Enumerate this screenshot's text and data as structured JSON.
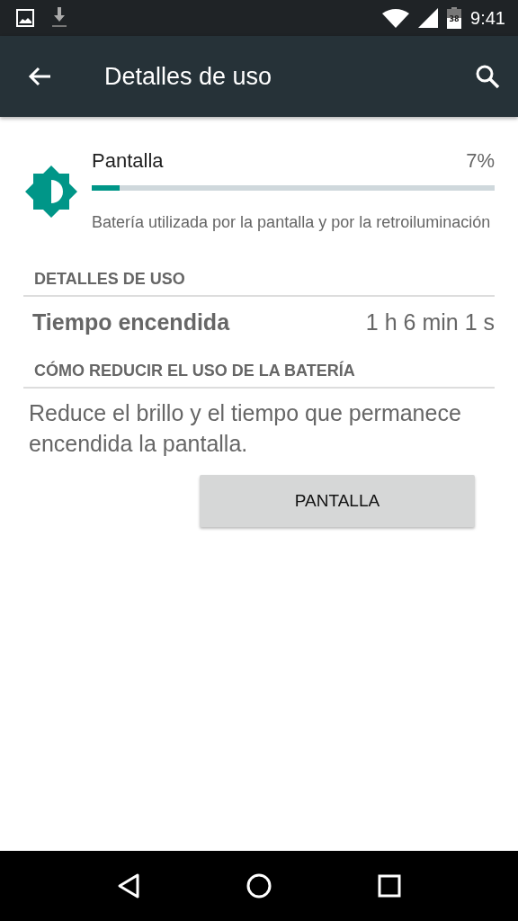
{
  "status_bar": {
    "battery_text": "38",
    "time": "9:41"
  },
  "app_bar": {
    "title": "Detalles de uso"
  },
  "usage": {
    "name": "Pantalla",
    "percent": "7%",
    "level": 0.07,
    "description": "Batería utilizada por la pantalla y por la retroiluminación"
  },
  "sections": [
    {
      "header": "DETALLES DE USO",
      "kind": "stat",
      "label": "Tiempo encendida",
      "value": "1 h 6 min 1 s"
    },
    {
      "header": "CÓMO REDUCIR EL USO DE LA BATERÍA",
      "kind": "tip",
      "text": "Reduce el brillo y el tiempo que permanece encendida la pantalla.",
      "button": "PANTALLA"
    }
  ]
}
